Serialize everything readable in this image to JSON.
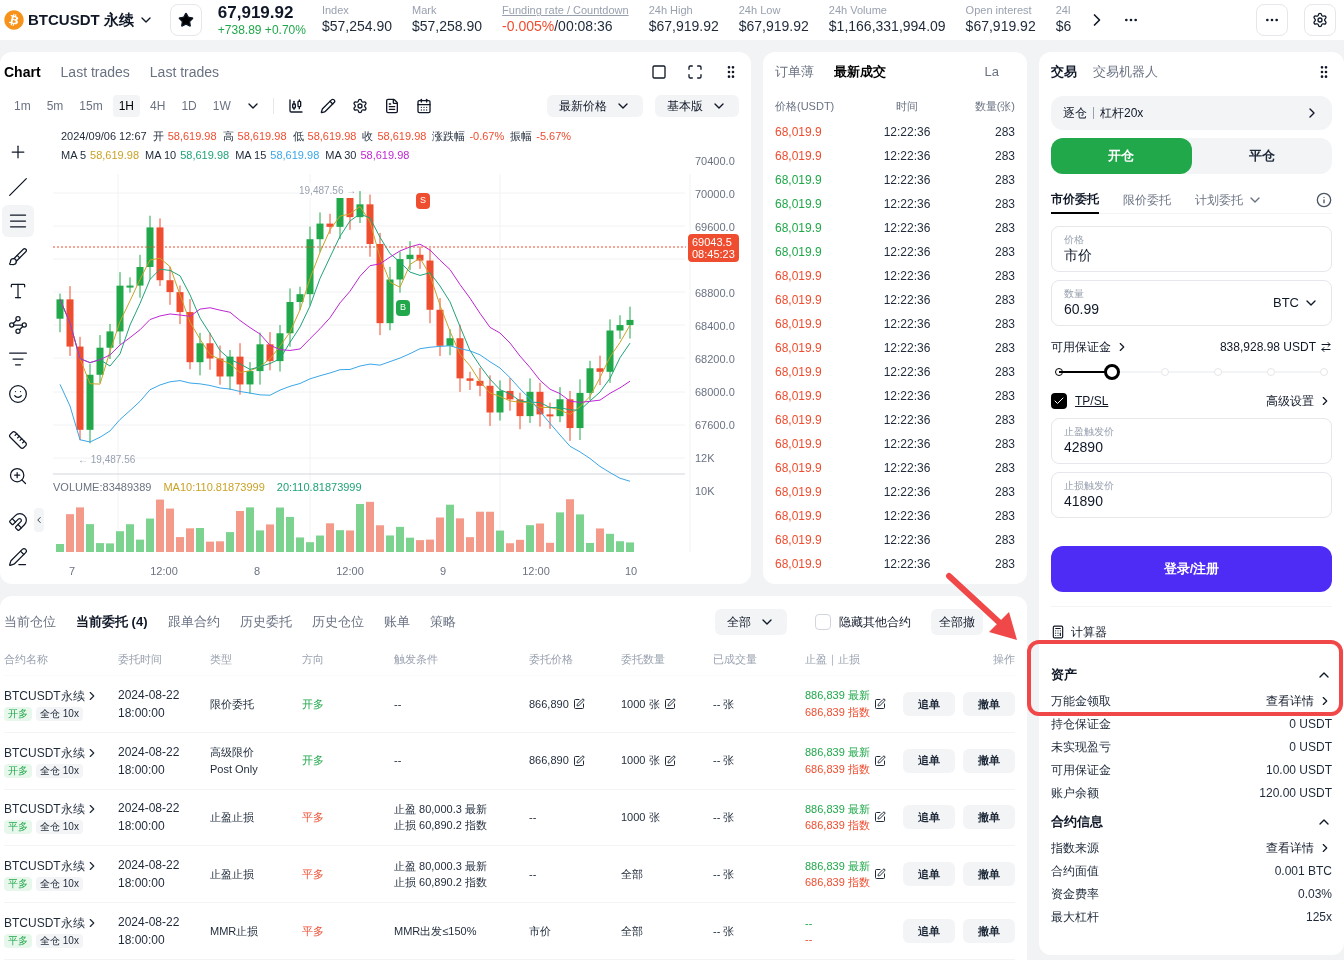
{
  "top_bar": {
    "symbol": "BTCUSDT 永续",
    "price": "67,919.92",
    "change": "+738.89 +0.70%",
    "stats": [
      {
        "kind": "plain",
        "label": "Index",
        "value": "$57,254.90"
      },
      {
        "kind": "plain",
        "label": "Mark",
        "value": "$57,258.90"
      },
      {
        "kind": "rate",
        "label": "Funding rate / Countdown",
        "value": "-0.005%",
        "suffix": "/00:08:36"
      },
      {
        "kind": "plain",
        "label": "24h High",
        "value": "$67,919.92"
      },
      {
        "kind": "plain",
        "label": "24h Low",
        "value": "$67,919.92"
      },
      {
        "kind": "plain",
        "label": "24h Volume",
        "value": "$1,166,331,994.09"
      },
      {
        "kind": "plain",
        "label": "Open interest",
        "value": "$67,919.92"
      },
      {
        "kind": "plain",
        "label": "24l",
        "value": "$6"
      }
    ]
  },
  "chart": {
    "tabs": [
      {
        "label": "Chart",
        "selected": true
      },
      {
        "label": "Last trades",
        "selected": false
      },
      {
        "label": "Last trades",
        "selected": false
      }
    ],
    "intervals": [
      {
        "label": "1m",
        "selected": false
      },
      {
        "label": "5m",
        "selected": false
      },
      {
        "label": "15m",
        "selected": false
      },
      {
        "label": "1H",
        "selected": true
      },
      {
        "label": "4H",
        "selected": false
      },
      {
        "label": "1D",
        "selected": false
      },
      {
        "label": "1W",
        "selected": false
      }
    ],
    "price_select": "最新价格",
    "version_select": "基本版",
    "tools": [
      {
        "kind": "crosshair",
        "selected": false
      },
      {
        "kind": "line",
        "selected": false
      },
      {
        "kind": "hlines",
        "selected": true
      },
      {
        "kind": "brush",
        "selected": false
      },
      {
        "kind": "text",
        "selected": false
      },
      {
        "kind": "nodes",
        "selected": false
      },
      {
        "kind": "fib",
        "selected": false
      },
      {
        "kind": "emoji",
        "selected": false
      },
      {
        "kind": "ruler",
        "selected": false
      },
      {
        "kind": "zoom",
        "selected": false
      },
      {
        "kind": "magnet",
        "selected": false
      },
      {
        "kind": "lock",
        "selected": false
      }
    ],
    "ohlc": {
      "date": "2024/09/06 12:67",
      "items": [
        {
          "label": "开",
          "value": "58,619.98"
        },
        {
          "label": "高",
          "value": "58,619.98"
        },
        {
          "label": "低",
          "value": "58,619.98"
        },
        {
          "label": "收",
          "value": "58,619.98"
        },
        {
          "label": "涨跌幅",
          "value": "-0.67%"
        },
        {
          "label": "振幅",
          "value": "-5.67%"
        }
      ]
    },
    "ma": [
      {
        "label": "MA 5",
        "value": "58,619.98",
        "color": "#c9a227"
      },
      {
        "label": "MA 10",
        "value": "58,619.98",
        "color": "#1fa37a"
      },
      {
        "label": "MA 15",
        "value": "58,619.98",
        "color": "#3ba6e8"
      },
      {
        "label": "MA 30",
        "value": "58,619.98",
        "color": "#c026d3"
      }
    ],
    "y_labels": [
      "70400.0",
      "70000.0",
      "69600.0",
      "68800.0",
      "68400.0",
      "68200.0",
      "68000.0",
      "67600.0",
      "12K",
      "10K"
    ],
    "price_tag": {
      "price": "69043.5",
      "time": "08:45:23"
    },
    "high_mark": "19,487.56 →",
    "low_mark": "← 19,487.56",
    "buy_mark": "B",
    "sell_mark": "S",
    "volume": [
      {
        "text": "VOLUME:83489389",
        "color": "#6b7280"
      },
      {
        "text": "MA10:110.81873999",
        "color": "#c9a227"
      },
      {
        "text": "20:110.81873999",
        "color": "#1fa37a"
      }
    ],
    "x_labels": [
      "7",
      "12:00",
      "8",
      "12:00",
      "9",
      "12:00",
      "10"
    ]
  },
  "order_book": {
    "tabs": [
      {
        "label": "订单薄",
        "selected": false
      },
      {
        "label": "最新成交",
        "selected": true
      },
      {
        "label": "La",
        "selected": false
      }
    ],
    "columns": [
      "价格(USDT)",
      "时间",
      "数量(张)"
    ],
    "trades": [
      {
        "price": "68,019.9",
        "time": "12:22:36",
        "amount": "283",
        "color": "#ef4d2f"
      },
      {
        "price": "68,019.9",
        "time": "12:22:36",
        "amount": "283",
        "color": "#ef4d2f"
      },
      {
        "price": "68,019.9",
        "time": "12:22:36",
        "amount": "283",
        "color": "#20a84a"
      },
      {
        "price": "68,019.9",
        "time": "12:22:36",
        "amount": "283",
        "color": "#20a84a"
      },
      {
        "price": "68,019.9",
        "time": "12:22:36",
        "amount": "283",
        "color": "#20a84a"
      },
      {
        "price": "68,019.9",
        "time": "12:22:36",
        "amount": "283",
        "color": "#20a84a"
      },
      {
        "price": "68,019.9",
        "time": "12:22:36",
        "amount": "283",
        "color": "#ef4d2f"
      },
      {
        "price": "68,019.9",
        "time": "12:22:36",
        "amount": "283",
        "color": "#ef4d2f"
      },
      {
        "price": "68,019.9",
        "time": "12:22:36",
        "amount": "283",
        "color": "#ef4d2f"
      },
      {
        "price": "68,019.9",
        "time": "12:22:36",
        "amount": "283",
        "color": "#ef4d2f"
      },
      {
        "price": "68,019.9",
        "time": "12:22:36",
        "amount": "283",
        "color": "#ef4d2f"
      },
      {
        "price": "68,019.9",
        "time": "12:22:36",
        "amount": "283",
        "color": "#ef4d2f"
      },
      {
        "price": "68,019.9",
        "time": "12:22:36",
        "amount": "283",
        "color": "#ef4d2f"
      },
      {
        "price": "68,019.9",
        "time": "12:22:36",
        "amount": "283",
        "color": "#ef4d2f"
      },
      {
        "price": "68,019.9",
        "time": "12:22:36",
        "amount": "283",
        "color": "#ef4d2f"
      },
      {
        "price": "68,019.9",
        "time": "12:22:36",
        "amount": "283",
        "color": "#ef4d2f"
      },
      {
        "price": "68,019.9",
        "time": "12:22:36",
        "amount": "283",
        "color": "#ef4d2f"
      },
      {
        "price": "68,019.9",
        "time": "12:22:36",
        "amount": "283",
        "color": "#ef4d2f"
      },
      {
        "price": "68,019.9",
        "time": "12:22:36",
        "amount": "283",
        "color": "#ef4d2f"
      }
    ]
  },
  "trade_panel": {
    "tabs": [
      {
        "label": "交易",
        "selected": true
      },
      {
        "label": "交易机器人",
        "selected": false
      }
    ],
    "margin_mode": "逐仓",
    "leverage": "杠杆20x",
    "sides": [
      {
        "label": "开仓",
        "selected": true
      },
      {
        "label": "平仓",
        "selected": false
      }
    ],
    "order_types": [
      {
        "label": "市价委托",
        "selected": true,
        "dropdown": false
      },
      {
        "label": "限价委托",
        "selected": false,
        "dropdown": false
      },
      {
        "label": "计划委托",
        "selected": false,
        "dropdown": true
      }
    ],
    "price_field": {
      "label": "价格",
      "value": "市价"
    },
    "amount_field": {
      "label": "数量",
      "value": "60.99",
      "unit": "BTC"
    },
    "available": {
      "label": "可用保证金",
      "value": "838,928.98 USDT"
    },
    "slider": {
      "level": 0.2
    },
    "tpsl": {
      "label": "TP/SL",
      "checked": true,
      "advanced": "高级设置"
    },
    "tp_field": {
      "label": "止盈触发价",
      "value": "42890"
    },
    "sl_field": {
      "label": "止损触发价",
      "value": "41890"
    },
    "submit": "登录/注册",
    "calculator": "计算器",
    "sections": [
      {
        "title": "资产",
        "expanded": true,
        "rows": [
          {
            "kind": "link",
            "label": "万能金领取",
            "value": "查看详情"
          },
          {
            "kind": "value",
            "label": "持仓保证金",
            "value": "0 USDT"
          },
          {
            "kind": "value",
            "label": "未实现盈亏",
            "value": "0 USDT"
          },
          {
            "kind": "value",
            "label": "可用保证金",
            "value": "10.00 USDT"
          },
          {
            "kind": "value",
            "label": "账户余额",
            "value": "120.00 USDT"
          }
        ]
      },
      {
        "title": "合约信息",
        "expanded": true,
        "rows": [
          {
            "kind": "link",
            "label": "指数来源",
            "value": "查看详情"
          },
          {
            "kind": "value",
            "label": "合约面值",
            "value": "0.001 BTC"
          },
          {
            "kind": "value",
            "label": "资金费率",
            "value": "0.03%"
          },
          {
            "kind": "value",
            "label": "最大杠杆",
            "value": "125x"
          }
        ]
      }
    ]
  },
  "orders": {
    "tabs": [
      {
        "label": "当前仓位",
        "selected": false
      },
      {
        "label": "当前委托 (4)",
        "selected": true
      },
      {
        "label": "跟单合约",
        "selected": false
      },
      {
        "label": "历史委托",
        "selected": false
      },
      {
        "label": "历史仓位",
        "selected": false
      },
      {
        "label": "账单",
        "selected": false
      },
      {
        "label": "策略",
        "selected": false
      }
    ],
    "filter": "全部",
    "hide_others": {
      "label": "隐藏其他合约",
      "checked": false
    },
    "cancel_all": "全部撤",
    "columns": [
      "合约名称",
      "委托时间",
      "类型",
      "方向",
      "触发条件",
      "委托价格",
      "委托数量",
      "已成交量",
      "止盈｜止损",
      "操作"
    ],
    "rows": [
      {
        "name": "BTCUSDT永续",
        "side_tag": "开多",
        "margin_tag": "全仓 10x",
        "date": "2024-08-22",
        "time": "18:00:00",
        "type": [
          "限价委托"
        ],
        "direction": "开多",
        "kind": "open",
        "trigger": [
          "--"
        ],
        "price": "866,890",
        "price_editable": true,
        "qty": "1000 张",
        "qty_editable": true,
        "filled": "-- 张",
        "tp": "886,839 最新",
        "sl": "686,839 指数",
        "tpsl_editable": true,
        "actions": [
          "追单",
          "撤单"
        ]
      },
      {
        "name": "BTCUSDT永续",
        "side_tag": "开多",
        "margin_tag": "全仓 10x",
        "date": "2024-08-22",
        "time": "18:00:00",
        "type": [
          "高级限价",
          "Post Only"
        ],
        "direction": "开多",
        "kind": "open",
        "trigger": [
          "--"
        ],
        "price": "866,890",
        "price_editable": true,
        "qty": "1000 张",
        "qty_editable": true,
        "filled": "-- 张",
        "tp": "886,839 最新",
        "sl": "686,839 指数",
        "tpsl_editable": true,
        "actions": [
          "追单",
          "撤单"
        ]
      },
      {
        "name": "BTCUSDT永续",
        "side_tag": "平多",
        "margin_tag": "全仓 10x",
        "date": "2024-08-22",
        "time": "18:00:00",
        "type": [
          "止盈止损"
        ],
        "direction": "平多",
        "kind": "close",
        "trigger": [
          "止盈 80,000.3 最新",
          "止损 60,890.2 指数"
        ],
        "price": "--",
        "price_editable": false,
        "qty": "1000 张",
        "qty_editable": false,
        "filled": "-- 张",
        "tp": "886,839 最新",
        "sl": "686,839 指数",
        "tpsl_editable": true,
        "actions": [
          "追单",
          "撤单"
        ]
      },
      {
        "name": "BTCUSDT永续",
        "side_tag": "平多",
        "margin_tag": "全仓 10x",
        "date": "2024-08-22",
        "time": "18:00:00",
        "type": [
          "止盈止损"
        ],
        "direction": "平多",
        "kind": "close",
        "trigger": [
          "止盈 80,000.3 最新",
          "止损 60,890.2 指数"
        ],
        "price": "--",
        "price_editable": false,
        "qty": "全部",
        "qty_editable": false,
        "filled": "-- 张",
        "tp": "886,839 最新",
        "sl": "686,839 指数",
        "tpsl_editable": true,
        "actions": [
          "追单",
          "撤单"
        ]
      },
      {
        "name": "BTCUSDT永续",
        "side_tag": "平多",
        "margin_tag": "全仓 10x",
        "date": "2024-08-22",
        "time": "18:00:00",
        "type": [
          "MMR止损"
        ],
        "direction": "平多",
        "kind": "close",
        "trigger": [
          "MMR出发≤150%"
        ],
        "price": "市价",
        "price_editable": false,
        "qty": "全部",
        "qty_editable": false,
        "filled": "-- 张",
        "tp": "--",
        "sl": "--",
        "tpsl_editable": false,
        "actions": [
          "追单",
          "撤单"
        ]
      }
    ]
  }
}
